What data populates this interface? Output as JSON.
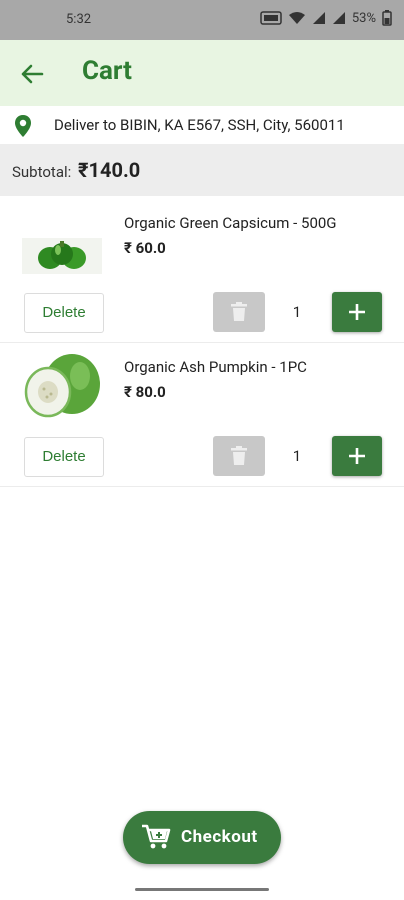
{
  "status_bar": {
    "time": "5:32",
    "battery": "53%"
  },
  "header": {
    "title": "Cart"
  },
  "delivery": {
    "address": "Deliver to BIBIN, KA E567, SSH, City, 560011"
  },
  "subtotal": {
    "label": "Subtotal:",
    "value": "₹140.0"
  },
  "items": [
    {
      "name": "Organic Green Capsicum - 500G",
      "price": "₹ 60.0",
      "quantity": "1",
      "delete_label": "Delete"
    },
    {
      "name": "Organic Ash Pumpkin - 1PC",
      "price": "₹ 80.0",
      "quantity": "1",
      "delete_label": "Delete"
    }
  ],
  "checkout": {
    "label": "Checkout"
  },
  "colors": {
    "brand": "#3a7b3e",
    "title": "#2e7d32",
    "header_bg": "#e8f5e2",
    "subtotal_bg": "#ededed"
  }
}
